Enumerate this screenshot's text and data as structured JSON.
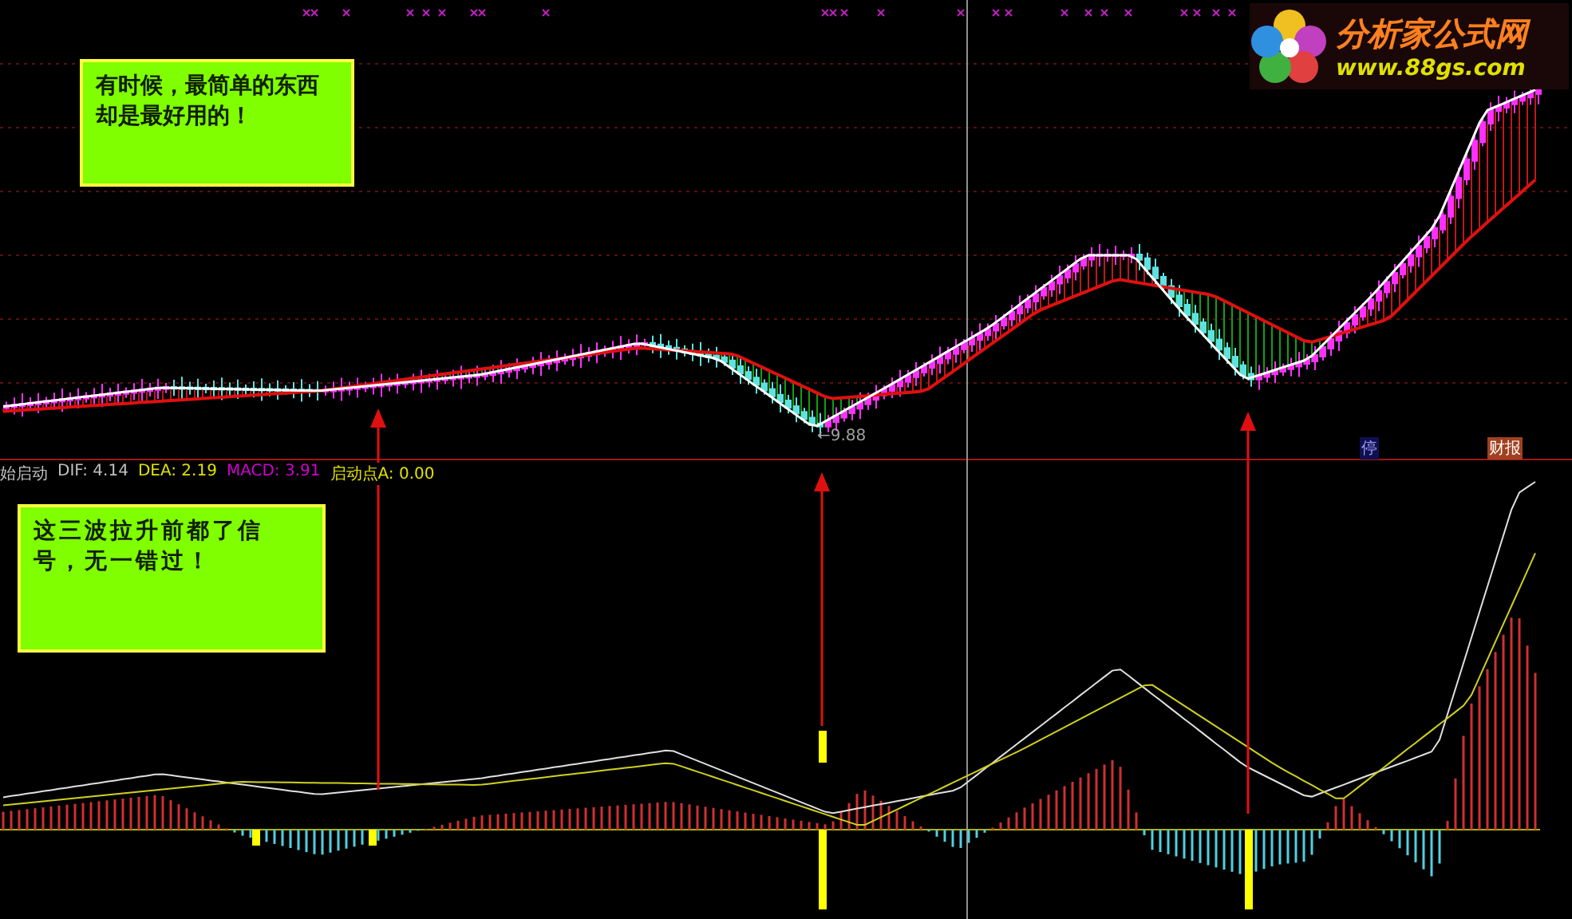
{
  "logo": {
    "title": "分析家公式网",
    "url": "www.88gs.com"
  },
  "price_panel": {
    "note": "有时候，最简单的东西却是最好用的！",
    "low_label": "←9.88",
    "markers": [
      {
        "text": "停",
        "kind": "halt"
      },
      {
        "text": "财报",
        "kind": "report"
      }
    ]
  },
  "indicator_panel": {
    "legend": [
      {
        "text": "始启动",
        "color": "#c0c0c0"
      },
      {
        "text": "DIF: 4.14",
        "color": "#c0c0c0"
      },
      {
        "text": "DEA: 2.19",
        "color": "#e0e000"
      },
      {
        "text": "MACD: 3.91",
        "color": "#d000d0"
      },
      {
        "text": "启动点A: 0.00",
        "color": "#e0e000"
      }
    ],
    "note": "这三波拉升前都了信号，无一错过！"
  }
}
